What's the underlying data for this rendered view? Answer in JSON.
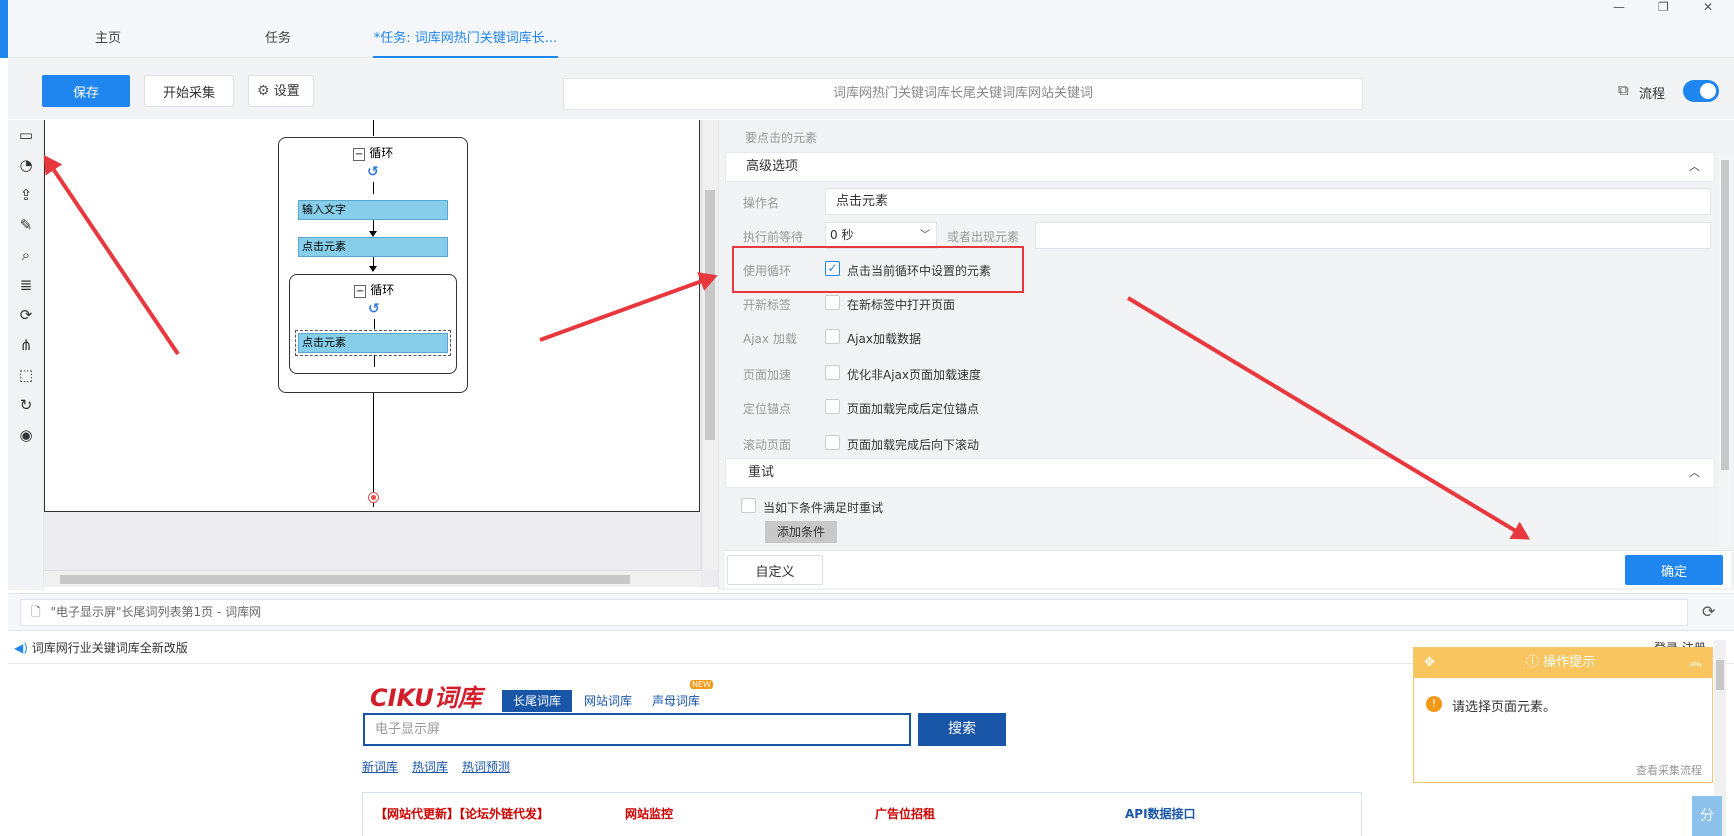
{
  "tabs": [
    {
      "label": "主页"
    },
    {
      "label": "任务"
    },
    {
      "label": "*任务: 词库网热门关键词库长..."
    }
  ],
  "toolbar": {
    "save_label": "保存",
    "start_label": "开始采集",
    "settings_label": "设置",
    "task_title": "词库网热门关键词库长尾关键词库网站关键词",
    "flow_label": "流程",
    "flow_on": true
  },
  "flow": {
    "loop1_label": "循环",
    "node_input": "输入文字",
    "node_click": "点击元素",
    "loop2_label": "循环",
    "node_click_inner": "点击元素"
  },
  "panel": {
    "element_header": "要点击的元素",
    "advanced_header": "高级选项",
    "op_name_label": "操作名",
    "op_name_value": "点击元素",
    "wait_label": "执行前等待",
    "wait_value": "0 秒",
    "or_appear_label": "或者出现元素",
    "use_loop_label": "使用循环",
    "use_loop_option": "点击当前循环中设置的元素",
    "new_tab_label": "开新标签",
    "new_tab_option": "在新标签中打开页面",
    "ajax_label": "Ajax 加载",
    "ajax_option": "Ajax加载数据",
    "speed_label": "页面加速",
    "speed_option": "优化非Ajax页面加载速度",
    "anchor_label": "定位锚点",
    "anchor_option": "页面加载完成后定位锚点",
    "scroll_label": "滚动页面",
    "scroll_option": "页面加载完成后向下滚动",
    "retry_header": "重试",
    "retry_option": "当如下条件满足时重试",
    "add_condition": "添加条件",
    "custom_label": "自定义",
    "confirm_label": "确定"
  },
  "browser": {
    "address": "\"电子显示屏\"长尾词列表第1页 - 词库网"
  },
  "page": {
    "notice": "词库网行业关键词库全新改版",
    "top_right": "登录 注册",
    "logo": "CIKU词库",
    "tab_long": "长尾词库",
    "tab_site": "网站词库",
    "tab_initial": "声母词库",
    "new_badge": "NEW",
    "search_value": "电子显示屏",
    "search_button": "搜索",
    "links": [
      "新词库",
      "热词库",
      "热词预测"
    ],
    "hot_links": [
      "【网站代更新】【论坛外链代发】",
      "网站监控",
      "广告位招租",
      "API数据接口"
    ]
  },
  "hint": {
    "title": "操作提示",
    "message": "请选择页面元素。",
    "footer": "查看采集流程",
    "side_button": "分"
  },
  "colors": {
    "accent": "#1f86ef",
    "node_fill": "#87ceeb",
    "annotation_red": "#e8383d",
    "hint_orange": "#f9c55f"
  }
}
